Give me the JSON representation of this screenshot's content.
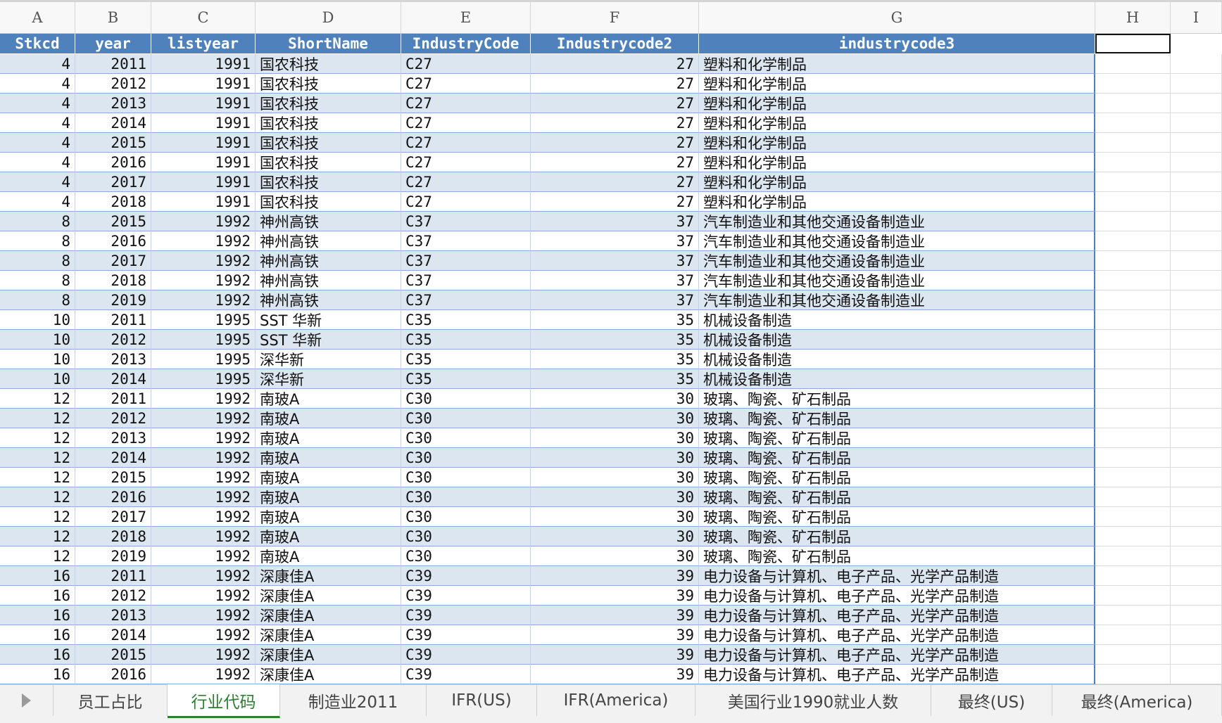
{
  "columns": [
    {
      "letter": "A"
    },
    {
      "letter": "B"
    },
    {
      "letter": "C"
    },
    {
      "letter": "D"
    },
    {
      "letter": "E"
    },
    {
      "letter": "F"
    },
    {
      "letter": "G"
    },
    {
      "letter": "H"
    },
    {
      "letter": "I"
    }
  ],
  "headers": [
    "Stkcd",
    "year",
    "listyear",
    "ShortName",
    "IndustryCode",
    "Industrycode2",
    "industrycode3"
  ],
  "rows": [
    [
      "4",
      "2011",
      "1991",
      "国农科技",
      "C27",
      "27",
      "塑料和化学制品"
    ],
    [
      "4",
      "2012",
      "1991",
      "国农科技",
      "C27",
      "27",
      "塑料和化学制品"
    ],
    [
      "4",
      "2013",
      "1991",
      "国农科技",
      "C27",
      "27",
      "塑料和化学制品"
    ],
    [
      "4",
      "2014",
      "1991",
      "国农科技",
      "C27",
      "27",
      "塑料和化学制品"
    ],
    [
      "4",
      "2015",
      "1991",
      "国农科技",
      "C27",
      "27",
      "塑料和化学制品"
    ],
    [
      "4",
      "2016",
      "1991",
      "国农科技",
      "C27",
      "27",
      "塑料和化学制品"
    ],
    [
      "4",
      "2017",
      "1991",
      "国农科技",
      "C27",
      "27",
      "塑料和化学制品"
    ],
    [
      "4",
      "2018",
      "1991",
      "国农科技",
      "C27",
      "27",
      "塑料和化学制品"
    ],
    [
      "8",
      "2015",
      "1992",
      "神州高铁",
      "C37",
      "37",
      "汽车制造业和其他交通设备制造业"
    ],
    [
      "8",
      "2016",
      "1992",
      "神州高铁",
      "C37",
      "37",
      "汽车制造业和其他交通设备制造业"
    ],
    [
      "8",
      "2017",
      "1992",
      "神州高铁",
      "C37",
      "37",
      "汽车制造业和其他交通设备制造业"
    ],
    [
      "8",
      "2018",
      "1992",
      "神州高铁",
      "C37",
      "37",
      "汽车制造业和其他交通设备制造业"
    ],
    [
      "8",
      "2019",
      "1992",
      "神州高铁",
      "C37",
      "37",
      "汽车制造业和其他交通设备制造业"
    ],
    [
      "10",
      "2011",
      "1995",
      "SST 华新",
      "C35",
      "35",
      "机械设备制造"
    ],
    [
      "10",
      "2012",
      "1995",
      "SST 华新",
      "C35",
      "35",
      "机械设备制造"
    ],
    [
      "10",
      "2013",
      "1995",
      "深华新",
      "C35",
      "35",
      "机械设备制造"
    ],
    [
      "10",
      "2014",
      "1995",
      "深华新",
      "C35",
      "35",
      "机械设备制造"
    ],
    [
      "12",
      "2011",
      "1992",
      "南玻A",
      "C30",
      "30",
      "玻璃、陶瓷、矿石制品"
    ],
    [
      "12",
      "2012",
      "1992",
      "南玻A",
      "C30",
      "30",
      "玻璃、陶瓷、矿石制品"
    ],
    [
      "12",
      "2013",
      "1992",
      "南玻A",
      "C30",
      "30",
      "玻璃、陶瓷、矿石制品"
    ],
    [
      "12",
      "2014",
      "1992",
      "南玻A",
      "C30",
      "30",
      "玻璃、陶瓷、矿石制品"
    ],
    [
      "12",
      "2015",
      "1992",
      "南玻A",
      "C30",
      "30",
      "玻璃、陶瓷、矿石制品"
    ],
    [
      "12",
      "2016",
      "1992",
      "南玻A",
      "C30",
      "30",
      "玻璃、陶瓷、矿石制品"
    ],
    [
      "12",
      "2017",
      "1992",
      "南玻A",
      "C30",
      "30",
      "玻璃、陶瓷、矿石制品"
    ],
    [
      "12",
      "2018",
      "1992",
      "南玻A",
      "C30",
      "30",
      "玻璃、陶瓷、矿石制品"
    ],
    [
      "12",
      "2019",
      "1992",
      "南玻A",
      "C30",
      "30",
      "玻璃、陶瓷、矿石制品"
    ],
    [
      "16",
      "2011",
      "1992",
      "深康佳A",
      "C39",
      "39",
      "电力设备与计算机、电子产品、光学产品制造"
    ],
    [
      "16",
      "2012",
      "1992",
      "深康佳A",
      "C39",
      "39",
      "电力设备与计算机、电子产品、光学产品制造"
    ],
    [
      "16",
      "2013",
      "1992",
      "深康佳A",
      "C39",
      "39",
      "电力设备与计算机、电子产品、光学产品制造"
    ],
    [
      "16",
      "2014",
      "1992",
      "深康佳A",
      "C39",
      "39",
      "电力设备与计算机、电子产品、光学产品制造"
    ],
    [
      "16",
      "2015",
      "1992",
      "深康佳A",
      "C39",
      "39",
      "电力设备与计算机、电子产品、光学产品制造"
    ],
    [
      "16",
      "2016",
      "1992",
      "深康佳A",
      "C39",
      "39",
      "电力设备与计算机、电子产品、光学产品制造"
    ]
  ],
  "tabs": [
    {
      "label": "员工占比",
      "active": false
    },
    {
      "label": "行业代码",
      "active": true
    },
    {
      "label": "制造业2011",
      "active": false
    },
    {
      "label": "IFR(US)",
      "active": false
    },
    {
      "label": "IFR(America)",
      "active": false
    },
    {
      "label": "美国行业1990就业人数",
      "active": false
    },
    {
      "label": "最终(US)",
      "active": false
    },
    {
      "label": "最终(America)",
      "active": false
    }
  ],
  "colors": {
    "header": "#4f81bd",
    "band": "#dce6f1",
    "active_tab": "#2e7d32"
  },
  "icons": {
    "tab_scroll": "play-triangle-icon"
  }
}
